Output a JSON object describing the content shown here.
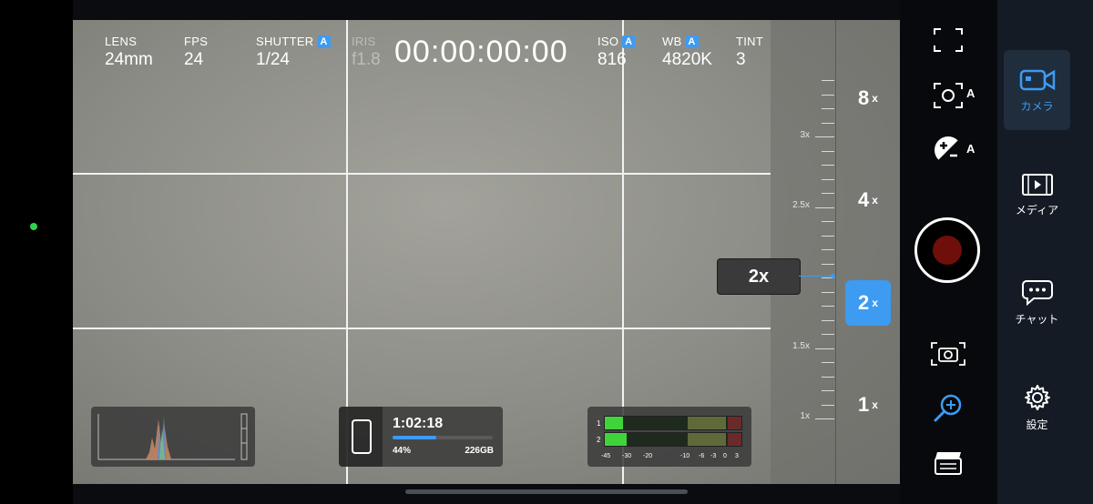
{
  "hud": {
    "lens": {
      "label": "LENS",
      "value": "24mm"
    },
    "fps": {
      "label": "FPS",
      "value": "24"
    },
    "shutter": {
      "label": "SHUTTER",
      "value": "1/24",
      "badge": "A"
    },
    "iris": {
      "label": "IRIS",
      "value": "f1.8"
    },
    "timecode": "00:00:00:00",
    "iso": {
      "label": "ISO",
      "value": "816",
      "badge": "A"
    },
    "wb": {
      "label": "WB",
      "value": "4820K",
      "badge": "A"
    },
    "tint": {
      "label": "TINT",
      "value": "3"
    }
  },
  "zoom": {
    "current_callout": "2x",
    "scale_labels": [
      "3x",
      "2.5x",
      "1.5x",
      "1x"
    ],
    "buttons": [
      {
        "value": "8",
        "suffix": "x"
      },
      {
        "value": "4",
        "suffix": "x"
      },
      {
        "value": "2",
        "suffix": "x",
        "active": true
      },
      {
        "value": "1",
        "suffix": "x"
      }
    ]
  },
  "storage": {
    "remaining_time": "1:02:18",
    "percent_label": "44%",
    "percent": 44,
    "free_space": "226GB"
  },
  "audio": {
    "channels": [
      "1",
      "2"
    ],
    "scale": [
      "-45",
      "-30",
      "-20",
      "-10",
      "-6",
      "-3",
      "0",
      "3"
    ]
  },
  "rail": {
    "auto_focus_badge": "A",
    "exposure_badge": "A"
  },
  "nav": {
    "items": [
      {
        "label": "カメラ",
        "active": true
      },
      {
        "label": "メディア"
      },
      {
        "label": "チャット"
      },
      {
        "label": "設定"
      }
    ]
  },
  "colors": {
    "accent": "#3d9bf2",
    "record": "#6e0f0c",
    "status_dot": "#2fd34a"
  }
}
